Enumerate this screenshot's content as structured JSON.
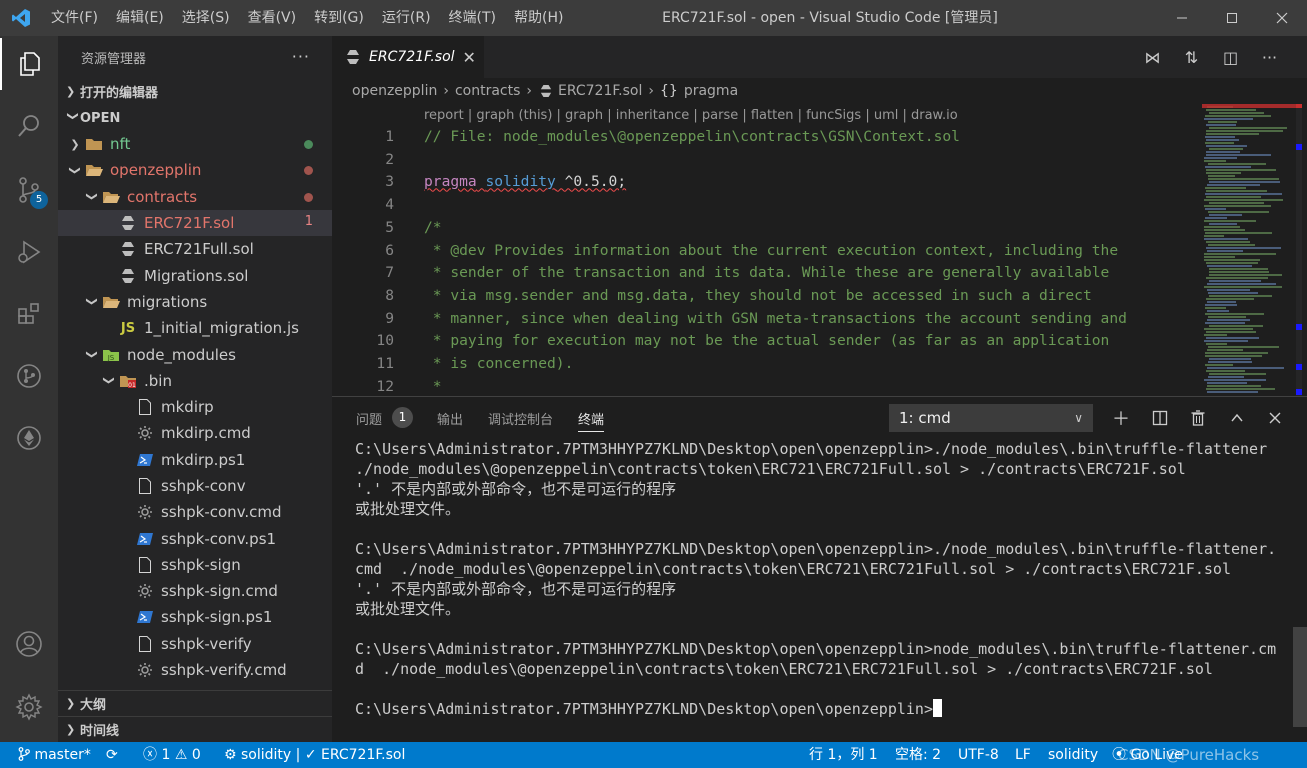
{
  "titlebar": {
    "menu": [
      "文件(F)",
      "编辑(E)",
      "选择(S)",
      "查看(V)",
      "转到(G)",
      "运行(R)",
      "终端(T)",
      "帮助(H)"
    ],
    "title": "ERC721F.sol - open - Visual Studio Code [管理员]"
  },
  "activity": {
    "scm_badge": "5"
  },
  "sidebar": {
    "header": "资源管理器",
    "more": "···",
    "open_editors": "打开的编辑器",
    "root": "OPEN",
    "outline": "大纲",
    "timeline": "时间线",
    "tree": [
      {
        "label": "nft",
        "depth": 1,
        "chev": "right",
        "icon": "folder",
        "color": "#73c991",
        "dot": "#4b8a5b"
      },
      {
        "label": "openzepplin",
        "depth": 1,
        "chev": "down",
        "icon": "folder-open",
        "color": "#e2756b",
        "dot": "#a0544d"
      },
      {
        "label": "contracts",
        "depth": 2,
        "chev": "down",
        "icon": "folder-open",
        "color": "#e2756b",
        "dot": "#a0544d"
      },
      {
        "label": "ERC721F.sol",
        "depth": 3,
        "chev": "",
        "icon": "solidity-file",
        "color": "#e2756b",
        "count": "1",
        "selected": true
      },
      {
        "label": "ERC721Full.sol",
        "depth": 3,
        "chev": "",
        "icon": "solidity-file",
        "color": "#cccccc"
      },
      {
        "label": "Migrations.sol",
        "depth": 3,
        "chev": "",
        "icon": "solidity-file",
        "color": "#cccccc"
      },
      {
        "label": "migrations",
        "depth": 2,
        "chev": "down",
        "icon": "folder-open",
        "color": "#cccccc"
      },
      {
        "label": "1_initial_migration.js",
        "depth": 3,
        "chev": "",
        "icon": "js-file",
        "color": "#cccccc"
      },
      {
        "label": "node_modules",
        "depth": 2,
        "chev": "down",
        "icon": "node-folder",
        "color": "#cccccc"
      },
      {
        "label": ".bin",
        "depth": 3,
        "chev": "down",
        "icon": "bin-folder",
        "color": "#cccccc"
      },
      {
        "label": "mkdirp",
        "depth": 4,
        "chev": "",
        "icon": "file",
        "color": "#cccccc"
      },
      {
        "label": "mkdirp.cmd",
        "depth": 4,
        "chev": "",
        "icon": "gear-file",
        "color": "#cccccc"
      },
      {
        "label": "mkdirp.ps1",
        "depth": 4,
        "chev": "",
        "icon": "powershell-file",
        "color": "#cccccc"
      },
      {
        "label": "sshpk-conv",
        "depth": 4,
        "chev": "",
        "icon": "file",
        "color": "#cccccc"
      },
      {
        "label": "sshpk-conv.cmd",
        "depth": 4,
        "chev": "",
        "icon": "gear-file",
        "color": "#cccccc"
      },
      {
        "label": "sshpk-conv.ps1",
        "depth": 4,
        "chev": "",
        "icon": "powershell-file",
        "color": "#cccccc"
      },
      {
        "label": "sshpk-sign",
        "depth": 4,
        "chev": "",
        "icon": "file",
        "color": "#cccccc"
      },
      {
        "label": "sshpk-sign.cmd",
        "depth": 4,
        "chev": "",
        "icon": "gear-file",
        "color": "#cccccc"
      },
      {
        "label": "sshpk-sign.ps1",
        "depth": 4,
        "chev": "",
        "icon": "powershell-file",
        "color": "#cccccc"
      },
      {
        "label": "sshpk-verify",
        "depth": 4,
        "chev": "",
        "icon": "file",
        "color": "#cccccc"
      },
      {
        "label": "sshpk-verify.cmd",
        "depth": 4,
        "chev": "",
        "icon": "gear-file",
        "color": "#cccccc"
      }
    ]
  },
  "editor": {
    "tab_label": "ERC721F.sol",
    "breadcrumb": [
      "openzepplin",
      "contracts",
      "ERC721F.sol",
      "pragma"
    ],
    "codelens": "report | graph (this) | graph | inheritance | parse | flatten | funcSigs | uml | draw.io",
    "lines": [
      {
        "n": "1",
        "parts": [
          {
            "t": "// File: node_modules\\@openzeppelin\\contracts\\GSN\\Context.sol",
            "c": "cmt"
          }
        ]
      },
      {
        "n": "2",
        "parts": []
      },
      {
        "n": "3",
        "parts": [
          {
            "t": "pragma",
            "c": "kw squiggle"
          },
          {
            "t": " ",
            "c": "txt squiggle"
          },
          {
            "t": "solidity",
            "c": "kw2 squiggle"
          },
          {
            "t": " ^0.5.0;",
            "c": "txt squiggle"
          }
        ]
      },
      {
        "n": "4",
        "parts": []
      },
      {
        "n": "5",
        "parts": [
          {
            "t": "/*",
            "c": "cmt"
          }
        ]
      },
      {
        "n": "6",
        "parts": [
          {
            "t": " * @dev Provides information about the current execution context, including the",
            "c": "cmt"
          }
        ]
      },
      {
        "n": "7",
        "parts": [
          {
            "t": " * sender of the transaction and its data. While these are generally available",
            "c": "cmt"
          }
        ]
      },
      {
        "n": "8",
        "parts": [
          {
            "t": " * via msg.sender and msg.data, they should not be accessed in such a direct",
            "c": "cmt"
          }
        ]
      },
      {
        "n": "9",
        "parts": [
          {
            "t": " * manner, since when dealing with GSN meta-transactions the account sending and",
            "c": "cmt"
          }
        ]
      },
      {
        "n": "10",
        "parts": [
          {
            "t": " * paying for execution may not be the actual sender (as far as an application",
            "c": "cmt"
          }
        ]
      },
      {
        "n": "11",
        "parts": [
          {
            "t": " * is concerned).",
            "c": "cmt"
          }
        ]
      },
      {
        "n": "12",
        "parts": [
          {
            "t": " *",
            "c": "cmt"
          }
        ]
      }
    ]
  },
  "panel": {
    "tabs": [
      "问题",
      "输出",
      "调试控制台",
      "终端"
    ],
    "problems_count": "1",
    "terminal_select": "1: cmd",
    "terminal_lines": [
      "C:\\Users\\Administrator.7PTM3HHYPZ7KLND\\Desktop\\open\\openzepplin>./node_modules\\.bin\\truffle-flattener",
      "./node_modules\\@openzeppelin\\contracts\\token\\ERC721\\ERC721Full.sol > ./contracts\\ERC721F.sol",
      "'.' 不是内部或外部命令，也不是可运行的程序",
      "或批处理文件。",
      "",
      "C:\\Users\\Administrator.7PTM3HHYPZ7KLND\\Desktop\\open\\openzepplin>./node_modules\\.bin\\truffle-flattener.",
      "cmd  ./node_modules\\@openzeppelin\\contracts\\token\\ERC721\\ERC721Full.sol > ./contracts\\ERC721F.sol",
      "'.' 不是内部或外部命令，也不是可运行的程序",
      "或批处理文件。",
      "",
      "C:\\Users\\Administrator.7PTM3HHYPZ7KLND\\Desktop\\open\\openzepplin>node_modules\\.bin\\truffle-flattener.cm",
      "d  ./node_modules\\@openzeppelin\\contracts\\token\\ERC721\\ERC721Full.sol > ./contracts\\ERC721F.sol",
      ""
    ],
    "prompt": "C:\\Users\\Administrator.7PTM3HHYPZ7KLND\\Desktop\\open\\openzepplin>"
  },
  "statusbar": {
    "branch": "master*",
    "errors": "1",
    "warnings": "0",
    "solidity_item": "solidity | ✓ ERC721F.sol",
    "position": "行 1，列 1",
    "spaces": "空格: 2",
    "encoding": "UTF-8",
    "eol": "LF",
    "language": "solidity",
    "golive": "Go Live",
    "watermark": "CSDN @PureHacks"
  }
}
